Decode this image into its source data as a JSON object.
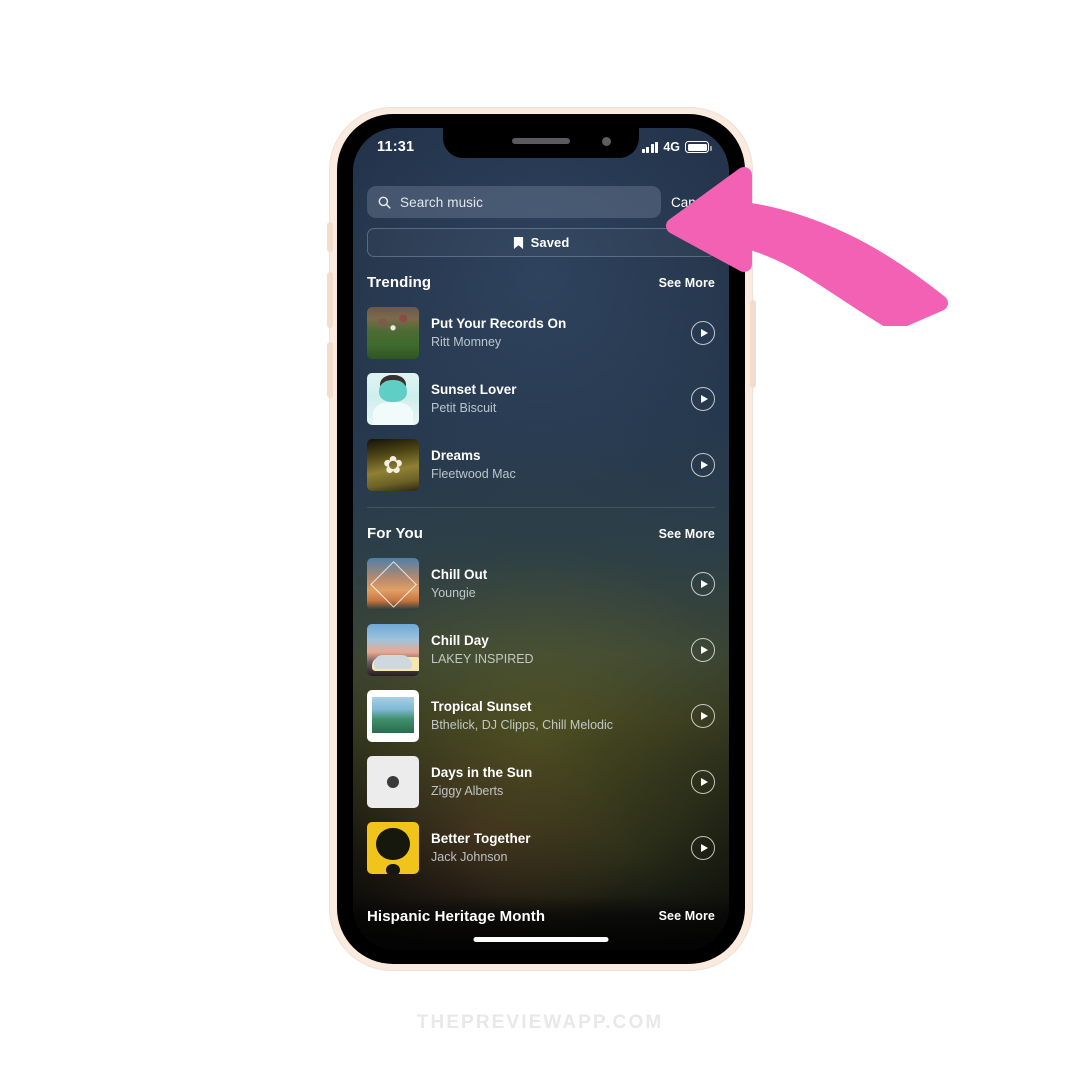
{
  "watermark": "THEPREVIEWAPP.COM",
  "status_bar": {
    "time": "11:31",
    "network": "4G"
  },
  "search": {
    "placeholder": "Search music",
    "value": "",
    "cancel_label": "Cancel"
  },
  "saved_chip": {
    "label": "Saved"
  },
  "sections": [
    {
      "title": "Trending",
      "see_more_label": "See More",
      "tracks": [
        {
          "title": "Put Your Records On",
          "artist": "Ritt Momney",
          "art": "art-records"
        },
        {
          "title": "Sunset Lover",
          "artist": "Petit Biscuit",
          "art": "art-sunset"
        },
        {
          "title": "Dreams",
          "artist": "Fleetwood Mac",
          "art": "art-dreams"
        }
      ]
    },
    {
      "title": "For You",
      "see_more_label": "See More",
      "tracks": [
        {
          "title": "Chill Out",
          "artist": "Youngie",
          "art": "art-chillout"
        },
        {
          "title": "Chill Day",
          "artist": "LAKEY INSPIRED",
          "art": "art-chillday"
        },
        {
          "title": "Tropical Sunset",
          "artist": "Bthelick, DJ Clipps, Chill Melodic",
          "art": "art-tropical"
        },
        {
          "title": "Days in the Sun",
          "artist": "Ziggy Alberts",
          "art": "art-days"
        },
        {
          "title": "Better Together",
          "artist": "Jack Johnson",
          "art": "art-better"
        }
      ]
    }
  ],
  "bottom_section": {
    "title": "Hispanic Heritage Month",
    "see_more_label": "See More"
  },
  "annotation_arrow": {
    "color": "#f261b4",
    "points_to": "cancel-button"
  }
}
